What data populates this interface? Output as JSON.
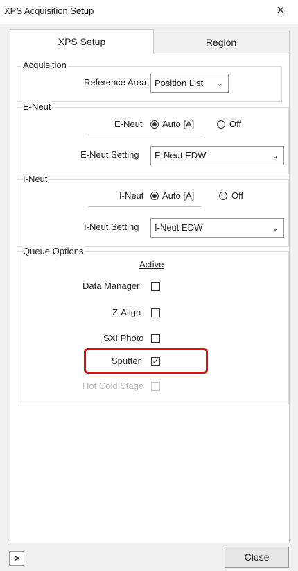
{
  "window": {
    "title": "XPS Acquisition Setup",
    "close_glyph": "×"
  },
  "tabs": [
    {
      "label": "XPS Setup"
    },
    {
      "label": "Region"
    }
  ],
  "acquisition": {
    "group_label": "Acquisition",
    "reference_area_label": "Reference Area",
    "reference_area_value": "Position List"
  },
  "eneut": {
    "group_label": "E-Neut",
    "radio_label": "E-Neut",
    "option_auto": "Auto [A]",
    "option_off": "Off",
    "setting_label": "E-Neut Setting",
    "setting_value": "E-Neut EDW"
  },
  "ineut": {
    "group_label": "I-Neut",
    "radio_label": "I-Neut",
    "option_auto": "Auto [A]",
    "option_off": "Off",
    "setting_label": "I-Neut Setting",
    "setting_value": "I-Neut EDW"
  },
  "queue": {
    "group_label": "Queue Options",
    "active_header": "Active",
    "items": [
      {
        "label": "Data Manager"
      },
      {
        "label": "Z-Align"
      },
      {
        "label": "SXI Photo"
      },
      {
        "label": "Sputter"
      },
      {
        "label": "Hot Cold Stage"
      }
    ]
  },
  "footer": {
    "expand_glyph": ">",
    "close_label": "Close"
  },
  "icons": {
    "chevron": "chevron-down-icon",
    "check": "✓"
  }
}
